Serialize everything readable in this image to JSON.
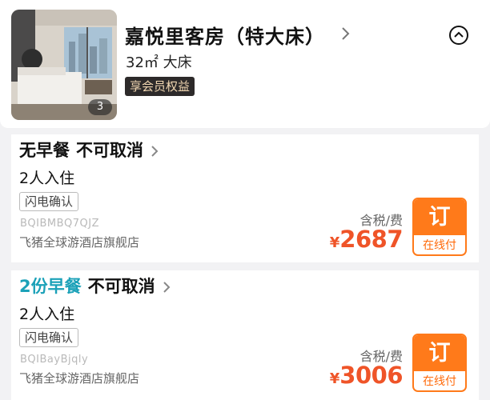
{
  "header": {
    "title": "嘉悦里客房（特大床）",
    "meta": "32㎡  大床",
    "member_badge": "享会员权益",
    "photo_count": "3"
  },
  "plans": [
    {
      "breakfast": "无早餐",
      "breakfast_color": "#111111",
      "cancel": "不可取消",
      "occupancy": "2人入住",
      "confirm": "闪电确认",
      "code": "BQIBMBQ7QJZ",
      "shop": "飞猪全球游酒店旗舰店",
      "tax_note": "含税/费",
      "currency": "¥",
      "price": "2687",
      "book_label": "订",
      "pay_label": "在线付"
    },
    {
      "breakfast": "2份早餐",
      "breakfast_color": "#1ba1b8",
      "cancel": "不可取消",
      "occupancy": "2人入住",
      "confirm": "闪电确认",
      "code": "BQIBayBjqly",
      "shop": "飞猪全球游酒店旗舰店",
      "tax_note": "含税/费",
      "currency": "¥",
      "price": "3006",
      "book_label": "订",
      "pay_label": "在线付"
    }
  ],
  "colors": {
    "accent_orange": "#ff7a1a",
    "price_red": "#ef5428",
    "breakfast_teal": "#1ba1b8"
  },
  "icons": {
    "title_chevron": "chevron-right-icon",
    "collapse": "chevron-up-circle-icon",
    "plan_chevron": "chevron-right-icon"
  }
}
